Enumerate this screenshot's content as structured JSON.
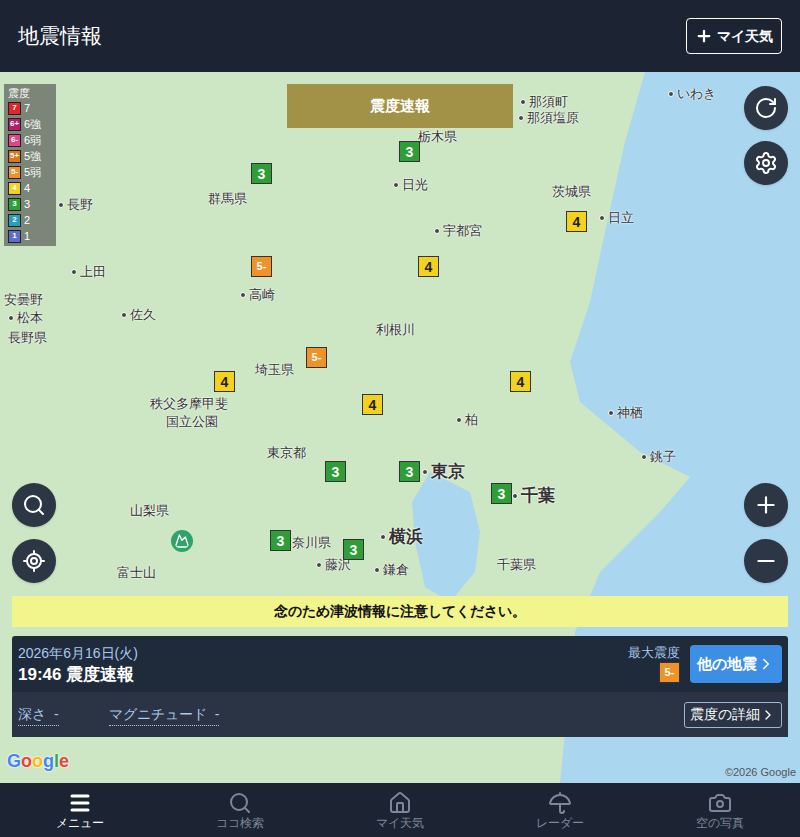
{
  "header": {
    "title": "地震情報",
    "my_weather_button": "マイ天気"
  },
  "banner": "震度速報",
  "legend": {
    "title": "震度",
    "levels": [
      {
        "code": "7",
        "label": "7",
        "color": "#e0262b"
      },
      {
        "code": "6+",
        "label": "6強",
        "color": "#b0206e"
      },
      {
        "code": "6-",
        "label": "6弱",
        "color": "#e2468a"
      },
      {
        "code": "5+",
        "label": "5強",
        "color": "#d9781a"
      },
      {
        "code": "5-",
        "label": "5弱",
        "color": "#f0922a"
      },
      {
        "code": "4",
        "label": "4",
        "color": "#f2d21c"
      },
      {
        "code": "3",
        "label": "3",
        "color": "#2f9e38"
      },
      {
        "code": "2",
        "label": "2",
        "color": "#2a9db8"
      },
      {
        "code": "1",
        "label": "1",
        "color": "#5b6fc4"
      }
    ]
  },
  "map_labels": [
    {
      "text": "那須町",
      "kind": "city"
    },
    {
      "text": "那須塩原",
      "kind": "city"
    },
    {
      "text": "栃木県",
      "kind": "region"
    },
    {
      "text": "いわき",
      "kind": "city"
    },
    {
      "text": "群馬県",
      "kind": "region"
    },
    {
      "text": "日光",
      "kind": "city"
    },
    {
      "text": "茨城県",
      "kind": "region"
    },
    {
      "text": "長野",
      "kind": "city"
    },
    {
      "text": "宇都宮",
      "kind": "city"
    },
    {
      "text": "日立",
      "kind": "city"
    },
    {
      "text": "上田",
      "kind": "city"
    },
    {
      "text": "高崎",
      "kind": "city"
    },
    {
      "text": "安曇野",
      "kind": "region"
    },
    {
      "text": "佐久",
      "kind": "city"
    },
    {
      "text": "松本",
      "kind": "city"
    },
    {
      "text": "長野県",
      "kind": "region"
    },
    {
      "text": "利根川",
      "kind": "region"
    },
    {
      "text": "埼玉県",
      "kind": "region"
    },
    {
      "text": "秩父多摩甲斐",
      "kind": "region"
    },
    {
      "text": "国立公園",
      "kind": "region"
    },
    {
      "text": "神栖",
      "kind": "city"
    },
    {
      "text": "柏",
      "kind": "city"
    },
    {
      "text": "東京都",
      "kind": "region"
    },
    {
      "text": "東京",
      "kind": "major"
    },
    {
      "text": "銚子",
      "kind": "city"
    },
    {
      "text": "千葉",
      "kind": "major"
    },
    {
      "text": "山梨県",
      "kind": "region"
    },
    {
      "text": "富士山",
      "kind": "region"
    },
    {
      "text": "横浜",
      "kind": "major"
    },
    {
      "text": "奈川県",
      "kind": "region"
    },
    {
      "text": "藤沢",
      "kind": "city"
    },
    {
      "text": "鎌倉",
      "kind": "city"
    },
    {
      "text": "千葉県",
      "kind": "region"
    }
  ],
  "pins": [
    {
      "level": "3",
      "color": "#2f9e38"
    },
    {
      "level": "3",
      "color": "#2f9e38"
    },
    {
      "level": "4",
      "color": "#f2d21c"
    },
    {
      "level": "5-",
      "color": "#f0922a"
    },
    {
      "level": "4",
      "color": "#f2d21c"
    },
    {
      "level": "5-",
      "color": "#f0922a"
    },
    {
      "level": "4",
      "color": "#f2d21c"
    },
    {
      "level": "4",
      "color": "#f2d21c"
    },
    {
      "level": "4",
      "color": "#f2d21c"
    },
    {
      "level": "3",
      "color": "#2f9e38"
    },
    {
      "level": "3",
      "color": "#2f9e38"
    },
    {
      "level": "3",
      "color": "#2f9e38"
    },
    {
      "level": "3",
      "color": "#2f9e38"
    },
    {
      "level": "3",
      "color": "#2f9e38"
    }
  ],
  "notice": "念のため津波情報に注意してください。",
  "info": {
    "date": "2026年6月16日(火)",
    "headline": "19:46 震度速報",
    "max_label": "最大震度",
    "max_level": "5-",
    "max_color": "#f0922a",
    "other_button": "他の地震",
    "depth_label": "深さ",
    "depth_value": "-",
    "magnitude_label": "マグニチュード",
    "magnitude_value": "-",
    "details_button": "震度の詳細"
  },
  "attribution": {
    "logo": "Google",
    "copyright": "©2026 Google"
  },
  "nav": [
    {
      "label": "メニュー",
      "selected": true
    },
    {
      "label": "ココ検索",
      "selected": false
    },
    {
      "label": "マイ天気",
      "selected": false
    },
    {
      "label": "レーダー",
      "selected": false
    },
    {
      "label": "空の写真",
      "selected": false
    }
  ]
}
